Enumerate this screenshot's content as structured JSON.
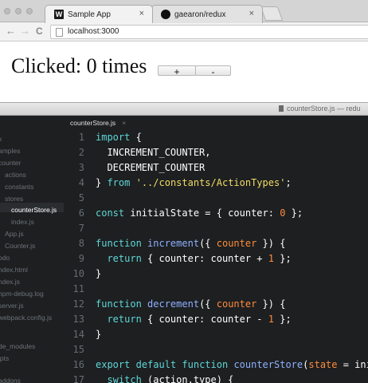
{
  "browser": {
    "tabs": [
      {
        "title": "Sample App",
        "icon": "w-logo-icon",
        "close": "×"
      },
      {
        "title": "gaearon/redux",
        "icon": "github-icon",
        "close": "×"
      }
    ],
    "nav": {
      "back": "←",
      "forward": "→",
      "reload": "C"
    },
    "url": "localhost:3000"
  },
  "page": {
    "clicked_text": "Clicked: 0 times",
    "increment_label": "+",
    "decrement_label": "-"
  },
  "editor": {
    "window_title": "counterStore.js — redu",
    "active_tab": "counterStore.js",
    "tab_close": "×",
    "sidebar": [
      {
        "label": "x",
        "active": false
      },
      {
        "label": "amples",
        "active": false
      },
      {
        "label": "counter",
        "active": false
      },
      {
        "label": "actions",
        "active": false
      },
      {
        "label": "constants",
        "active": false
      },
      {
        "label": "stores",
        "active": false
      },
      {
        "label": "counterStore.js",
        "active": true
      },
      {
        "label": "index.js",
        "active": false
      },
      {
        "label": "App.js",
        "active": false
      },
      {
        "label": "Counter.js",
        "active": false
      },
      {
        "label": "odo",
        "active": false
      },
      {
        "label": "ndex.html",
        "active": false
      },
      {
        "label": "ndex.js",
        "active": false
      },
      {
        "label": "npm-debug.log",
        "active": false
      },
      {
        "label": "server.js",
        "active": false
      },
      {
        "label": "webpack.config.js",
        "active": false
      },
      {
        "label": "de_modules",
        "active": false
      },
      {
        "label": "ipts",
        "active": false
      },
      {
        "label": "addons",
        "active": false
      }
    ],
    "code_lines": [
      {
        "n": "1",
        "t": [
          [
            "import",
            "kw"
          ],
          [
            " {",
            ""
          ]
        ]
      },
      {
        "n": "2",
        "t": [
          [
            "  INCREMENT_COUNTER,",
            ""
          ]
        ]
      },
      {
        "n": "3",
        "t": [
          [
            "  DECREMENT_COUNTER",
            ""
          ]
        ]
      },
      {
        "n": "4",
        "t": [
          [
            "} ",
            ""
          ],
          [
            "from",
            "kw"
          ],
          [
            " ",
            ""
          ],
          [
            "'../constants/ActionTypes'",
            "str"
          ],
          [
            ";",
            ""
          ]
        ]
      },
      {
        "n": "5",
        "t": []
      },
      {
        "n": "6",
        "t": [
          [
            "const",
            "kw"
          ],
          [
            " initialState = { counter: ",
            ""
          ],
          [
            "0",
            "num"
          ],
          [
            " };",
            ""
          ]
        ]
      },
      {
        "n": "7",
        "t": []
      },
      {
        "n": "8",
        "t": [
          [
            "function",
            "kw"
          ],
          [
            " ",
            ""
          ],
          [
            "increment",
            "fn"
          ],
          [
            "({ ",
            ""
          ],
          [
            "counter",
            "param"
          ],
          [
            " }) {",
            ""
          ]
        ]
      },
      {
        "n": "9",
        "t": [
          [
            "  ",
            ""
          ],
          [
            "return",
            "kw"
          ],
          [
            " { counter: counter + ",
            ""
          ],
          [
            "1",
            "num"
          ],
          [
            " };",
            ""
          ]
        ]
      },
      {
        "n": "10",
        "t": [
          [
            "}",
            ""
          ]
        ]
      },
      {
        "n": "11",
        "t": []
      },
      {
        "n": "12",
        "t": [
          [
            "function",
            "kw"
          ],
          [
            " ",
            ""
          ],
          [
            "decrement",
            "fn"
          ],
          [
            "({ ",
            ""
          ],
          [
            "counter",
            "param"
          ],
          [
            " }) {",
            ""
          ]
        ]
      },
      {
        "n": "13",
        "t": [
          [
            "  ",
            ""
          ],
          [
            "return",
            "kw"
          ],
          [
            " { counter: counter - ",
            ""
          ],
          [
            "1",
            "num"
          ],
          [
            " };",
            ""
          ]
        ]
      },
      {
        "n": "14",
        "t": [
          [
            "}",
            ""
          ]
        ]
      },
      {
        "n": "15",
        "t": []
      },
      {
        "n": "16",
        "t": [
          [
            "export",
            "kw"
          ],
          [
            " ",
            ""
          ],
          [
            "default",
            "kw"
          ],
          [
            " ",
            ""
          ],
          [
            "function",
            "kw"
          ],
          [
            " ",
            ""
          ],
          [
            "counterStore",
            "fn"
          ],
          [
            "(",
            ""
          ],
          [
            "state",
            "param"
          ],
          [
            " = initi",
            ""
          ]
        ]
      },
      {
        "n": "17",
        "t": [
          [
            "  ",
            ""
          ],
          [
            "switch",
            "kw"
          ],
          [
            " (action.type) {",
            ""
          ]
        ]
      }
    ]
  },
  "colors": {
    "editor_bg": "#1d1f21",
    "keyword": "#5fd7d7",
    "function_name": "#8fb0ff",
    "number": "#ff8c3a",
    "string": "#f2dc63"
  }
}
